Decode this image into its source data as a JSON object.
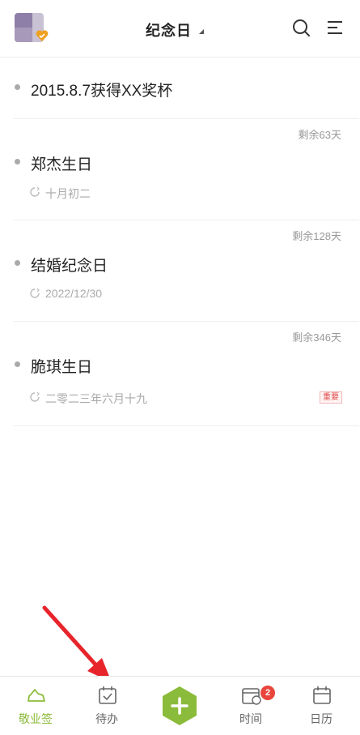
{
  "header": {
    "title": "纪念日",
    "avatar_icon": "avatar",
    "vip_icon": "vip-heart-badge-icon",
    "search_icon": "search-icon",
    "menu_icon": "menu-icon"
  },
  "items": [
    {
      "remaining": "",
      "name": "2015.8.7获得XX奖杯",
      "date": "",
      "tag": ""
    },
    {
      "remaining": "剩余63天",
      "name": "郑杰生日",
      "date": "十月初二",
      "tag": ""
    },
    {
      "remaining": "剩余128天",
      "name": "结婚纪念日",
      "date": "2022/12/30",
      "tag": ""
    },
    {
      "remaining": "剩余346天",
      "name": "脆琪生日",
      "date": "二零二三年六月十九",
      "tag": "重要"
    }
  ],
  "bottom_nav": {
    "items": [
      {
        "label": "敬业签",
        "icon": "cloud-icon",
        "active": true
      },
      {
        "label": "待办",
        "icon": "calendar-check-icon",
        "active": false
      },
      {
        "label": "",
        "icon": "add-icon",
        "active": false
      },
      {
        "label": "时间",
        "icon": "clock-calendar-icon",
        "active": false,
        "badge": "2"
      },
      {
        "label": "日历",
        "icon": "calendar-icon",
        "active": false
      }
    ]
  },
  "colors": {
    "accent_green": "#8bbb3a",
    "badge_red": "#e8453c",
    "arrow_red": "#e8242b"
  }
}
